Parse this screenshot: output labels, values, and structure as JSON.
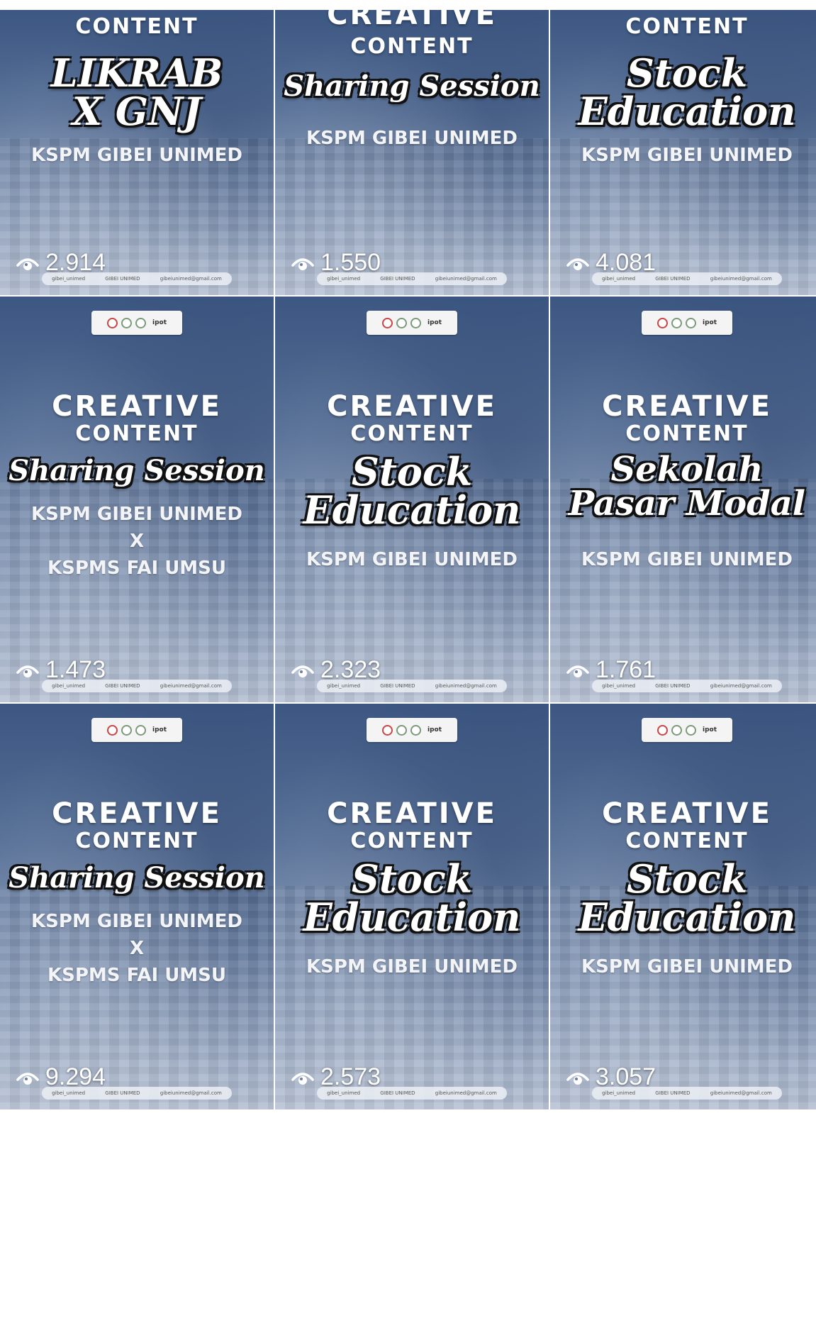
{
  "tiles": [
    {
      "logos": false,
      "creative": "",
      "content": "CONTENT",
      "script_lines": [
        "LIKRAB",
        "X GNJ"
      ],
      "org_lines": [
        "KSPM GIBEI UNIMED"
      ],
      "views": "2.914"
    },
    {
      "logos": false,
      "creative": "CREATIVE",
      "content": "CONTENT",
      "script_lines": [
        "Sharing Session"
      ],
      "org_lines": [
        "KSPM GIBEI UNIMED"
      ],
      "views": "1.550"
    },
    {
      "logos": false,
      "creative": "",
      "content": "CONTENT",
      "script_lines": [
        "Stock",
        "Education"
      ],
      "org_lines": [
        "KSPM GIBEI UNIMED"
      ],
      "views": "4.081"
    },
    {
      "logos": true,
      "creative": "CREATIVE",
      "content": "CONTENT",
      "script_lines": [
        "Sharing Session"
      ],
      "org_lines": [
        "KSPM GIBEI UNIMED",
        "X",
        "KSPMS FAI UMSU"
      ],
      "views": "1.473"
    },
    {
      "logos": true,
      "creative": "CREATIVE",
      "content": "CONTENT",
      "script_lines": [
        "Stock",
        "Education"
      ],
      "org_lines": [
        "KSPM GIBEI UNIMED"
      ],
      "views": "2.323"
    },
    {
      "logos": true,
      "creative": "CREATIVE",
      "content": "CONTENT",
      "script_lines": [
        "Sekolah",
        "Pasar Modal"
      ],
      "org_lines": [
        "KSPM GIBEI UNIMED"
      ],
      "views": "1.761"
    },
    {
      "logos": true,
      "creative": "CREATIVE",
      "content": "CONTENT",
      "script_lines": [
        "Sharing Session"
      ],
      "org_lines": [
        "KSPM GIBEI UNIMED",
        "X",
        "KSPMS FAI UMSU"
      ],
      "views": "9.294"
    },
    {
      "logos": true,
      "creative": "CREATIVE",
      "content": "CONTENT",
      "script_lines": [
        "Stock",
        "Education"
      ],
      "org_lines": [
        "KSPM GIBEI UNIMED"
      ],
      "views": "2.573"
    },
    {
      "logos": true,
      "creative": "CREATIVE",
      "content": "CONTENT",
      "script_lines": [
        "Stock",
        "Education"
      ],
      "org_lines": [
        "KSPM GIBEI UNIMED"
      ],
      "views": "3.057"
    }
  ],
  "footer": {
    "instagram": "gibei_unimed",
    "linkedin": "GIBEI UNIMED",
    "email": "gibeiunimed@gmail.com"
  },
  "logo_badge_text": "ipot",
  "icons": {
    "views": "eye-icon",
    "instagram": "instagram-icon",
    "linkedin": "linkedin-icon",
    "email": "mail-icon"
  },
  "colors": {
    "tile_top": "#3c5782",
    "tile_bottom": "#b5c0d3",
    "text": "#ffffff",
    "outline": "#111111"
  }
}
